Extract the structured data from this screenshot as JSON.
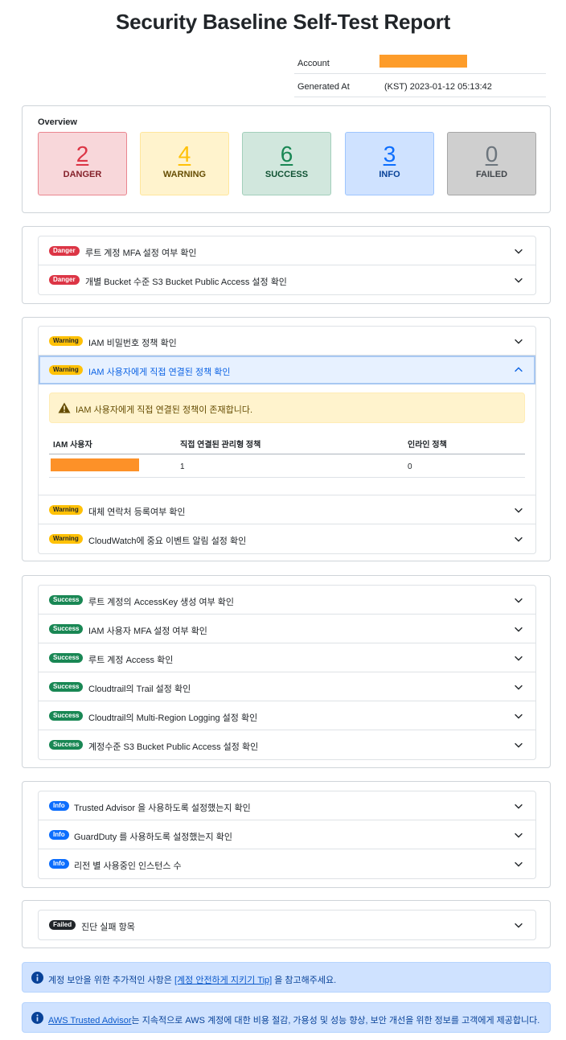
{
  "title": "Security Baseline Self-Test Report",
  "meta": {
    "account_label": "Account",
    "generated_label": "Generated At",
    "generated_value": "(KST) 2023-01-12 05:13:42"
  },
  "overview": {
    "heading": "Overview",
    "boxes": [
      {
        "count": "2",
        "label": "DANGER"
      },
      {
        "count": "4",
        "label": "WARNING"
      },
      {
        "count": "6",
        "label": "SUCCESS"
      },
      {
        "count": "3",
        "label": "INFO"
      },
      {
        "count": "0",
        "label": "FAILED"
      }
    ],
    "colors": {
      "danger": "#dc3545",
      "warning": "#ffc107",
      "success": "#198754",
      "info": "#0d6efd",
      "failed": "#6c757d"
    }
  },
  "danger": {
    "badge": "Danger",
    "items": [
      "루트 계정 MFA 설정 여부 확인",
      "개별 Bucket 수준 S3 Bucket Public Access 설정 확인"
    ]
  },
  "warning": {
    "badge": "Warning",
    "items": [
      "IAM 비밀번호 정책 확인",
      "IAM 사용자에게 직접 연결된 정책 확인",
      "대체 연락처 등록여부 확인",
      "CloudWatch에 중요 이벤트 알림 설정 확인"
    ],
    "expanded": {
      "alert": "IAM 사용자에게 직접 연결된 정책이 존재합니다.",
      "columns": [
        "IAM 사용자",
        "직접 연결된 관리형 정책",
        "인라인 정책"
      ],
      "row": {
        "managed": "1",
        "inline": "0"
      }
    }
  },
  "success": {
    "badge": "Success",
    "items": [
      "루트 계정의 AccessKey 생성 여부 확인",
      "IAM 사용자 MFA 설정 여부 확인",
      "루트 계정 Access 확인",
      "Cloudtrail의 Trail 설정 확인",
      "Cloudtrail의 Multi-Region Logging 설정 확인",
      "계정수준 S3 Bucket Public Access 설정 확인"
    ]
  },
  "info": {
    "badge": "Info",
    "items": [
      "Trusted Advisor 을 사용하도록 설정했는지 확인",
      "GuardDuty 를 사용하도록 설정했는지 확인",
      "리전 별 사용중인 인스턴스 수"
    ]
  },
  "failed": {
    "badge": "Failed",
    "items": [
      "진단 실패 항목"
    ]
  },
  "notes": {
    "tip_before": "계정 보안을 위한 추가적인 사항은 ",
    "tip_link": "[계정 안전하게 지키기 Tip]",
    "tip_after": " 을 참고해주세요.",
    "ta_link": "AWS Trusted Advisor",
    "ta_after": "는 지속적으로 AWS 계정에 대한 비용 절감, 가용성 및 성능 향상, 보안 개선을 위한 정보를 고객에게 제공합니다."
  }
}
